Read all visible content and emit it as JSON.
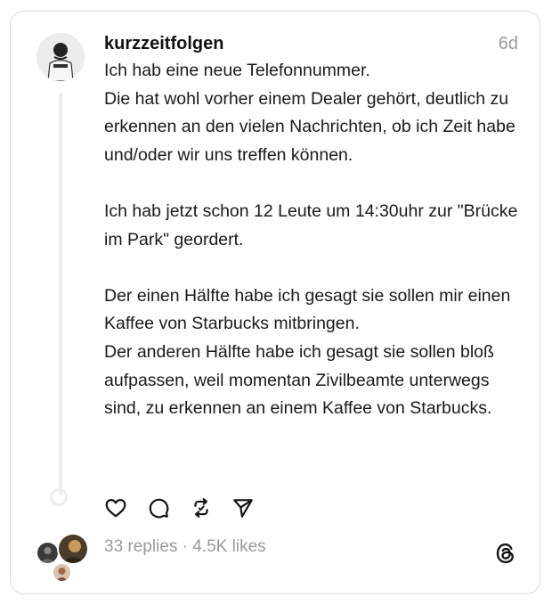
{
  "post": {
    "username": "kurzzeitfolgen",
    "time": "6d",
    "lines": [
      "Ich hab eine neue Telefonnummer.",
      "Die hat wohl vorher einem Dealer gehört, deutlich zu erkennen an den vielen Nachrichten, ob ich Zeit habe und/oder wir uns treffen können.",
      "",
      "Ich hab jetzt schon 12 Leute um 14:30uhr zur \"Brücke im Park\" geordert.",
      "",
      "Der einen Hälfte habe ich gesagt sie sollen mir einen Kaffee von Starbucks mitbringen.",
      "Der anderen Hälfte habe ich gesagt sie sollen bloß aufpassen, weil momentan Zivilbeamte unterwegs sind, zu erkennen an einem Kaffee von Starbucks."
    ]
  },
  "actions": {
    "like_icon": "heart-icon",
    "reply_icon": "comment-icon",
    "repost_icon": "repost-icon",
    "share_icon": "send-icon"
  },
  "stats": {
    "text": "33 replies · 4.5K likes"
  },
  "brand": {
    "logo_icon": "threads-logo-icon"
  }
}
